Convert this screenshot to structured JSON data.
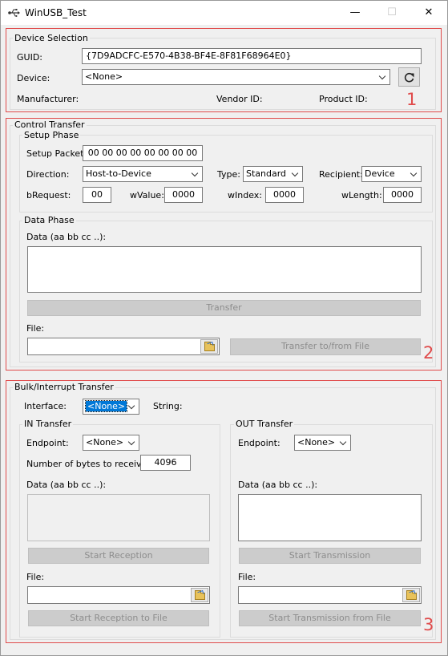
{
  "window": {
    "title": "WinUSB_Test",
    "minimize": "—",
    "maximize": "☐",
    "close": "✕"
  },
  "device_selection": {
    "title": "Device Selection",
    "guid_label": "GUID:",
    "guid_value": "{7D9ADCFC-E570-4B38-BF4E-8F81F68964E0}",
    "device_label": "Device:",
    "device_value": "<None>",
    "manufacturer_label": "Manufacturer:",
    "vendor_id_label": "Vendor ID:",
    "product_id_label": "Product ID:",
    "marker": "1"
  },
  "control_transfer": {
    "title": "Control Transfer",
    "setup_phase": {
      "title": "Setup Phase",
      "setup_packet_label": "Setup Packet:",
      "setup_packet_value": "00 00 00 00 00 00 00 00",
      "direction_label": "Direction:",
      "direction_value": "Host-to-Device",
      "type_label": "Type:",
      "type_value": "Standard",
      "recipient_label": "Recipient:",
      "recipient_value": "Device",
      "brequest_label": "bRequest:",
      "brequest_value": "00",
      "wvalue_label": "wValue:",
      "wvalue_value": "0000",
      "windex_label": "wIndex:",
      "windex_value": "0000",
      "wlength_label": "wLength:",
      "wlength_value": "0000"
    },
    "data_phase": {
      "title": "Data Phase",
      "data_label": "Data (aa bb cc ..):",
      "data_value": "",
      "transfer_button": "Transfer",
      "file_label": "File:",
      "file_value": "",
      "transfer_file_button": "Transfer to/from File"
    },
    "marker": "2"
  },
  "bulk_transfer": {
    "title": "Bulk/Interrupt Transfer",
    "interface_label": "Interface:",
    "interface_value": "<None>",
    "string_label": "String:",
    "in_transfer": {
      "title": "IN Transfer",
      "endpoint_label": "Endpoint:",
      "endpoint_value": "<None>",
      "bytes_label": "Number of bytes to receive:",
      "bytes_value": "4096",
      "data_label": "Data (aa bb cc ..):",
      "start_button": "Start Reception",
      "file_label": "File:",
      "file_value": "",
      "start_file_button": "Start Reception to File"
    },
    "out_transfer": {
      "title": "OUT Transfer",
      "endpoint_label": "Endpoint:",
      "endpoint_value": "<None>",
      "data_label": "Data (aa bb cc ..):",
      "start_button": "Start Transmission",
      "file_label": "File:",
      "file_value": "",
      "start_file_button": "Start Transmission from File"
    },
    "marker": "3"
  },
  "colors": {
    "annotation_red": "#e04b4b",
    "selection_blue": "#0078d7",
    "disabled_button": "#cccccc"
  }
}
